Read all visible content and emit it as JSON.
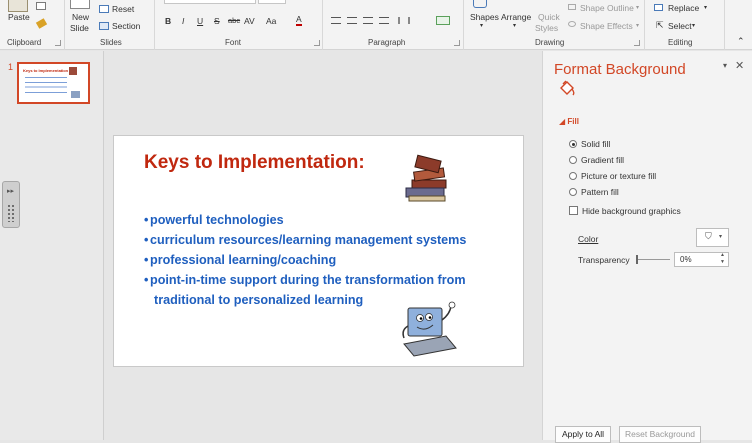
{
  "ribbon": {
    "clipboard": {
      "paste_label": "Paste",
      "group_label": "Clipboard"
    },
    "slides": {
      "new_slide_label": "New Slide",
      "new_slide_line1": "New",
      "new_slide_line2": "Slide",
      "reset_label": "Reset",
      "section_label": "Section",
      "group_label": "Slides"
    },
    "font": {
      "bold": "B",
      "italic": "I",
      "underline": "U",
      "strike": "S",
      "abc": "abc",
      "av": "AV",
      "aa": "Aa",
      "font_color": "A",
      "group_label": "Font"
    },
    "paragraph": {
      "group_label": "Paragraph"
    },
    "drawing": {
      "shape_outline": "Shape Outline",
      "shape_effects": "Shape Effects",
      "shapes_label": "Shapes",
      "arrange_label": "Arrange",
      "quick_styles_line1": "Quick",
      "quick_styles_line2": "Styles",
      "group_label": "Drawing"
    },
    "editing": {
      "replace_label": "Replace",
      "select_label": "Select",
      "group_label": "Editing"
    }
  },
  "thumbnails": [
    {
      "number": "1",
      "title": "Keys to Implementation"
    }
  ],
  "slide": {
    "title": "Keys to Implementation:",
    "bullets": [
      "powerful technologies",
      "curriculum resources/learning management systems",
      "professional learning/coaching",
      "point-in-time support during the transformation from"
    ],
    "continuation": "traditional to personalized learning"
  },
  "format_panel": {
    "title": "Format Background",
    "section_label": "Fill",
    "options": [
      {
        "label": "Solid fill",
        "selected": true
      },
      {
        "label": "Gradient fill",
        "selected": false
      },
      {
        "label": "Picture or texture fill",
        "selected": false
      },
      {
        "label": "Pattern fill",
        "selected": false
      }
    ],
    "hide_graphics_label": "Hide background graphics",
    "color_label": "Color",
    "transparency_label": "Transparency",
    "transparency_value": "0%",
    "apply_all_label": "Apply to All",
    "reset_label": "Reset Background"
  },
  "colors": {
    "accent": "#d24726",
    "title_red": "#c0280f",
    "bullet_blue": "#1f5fbf"
  }
}
